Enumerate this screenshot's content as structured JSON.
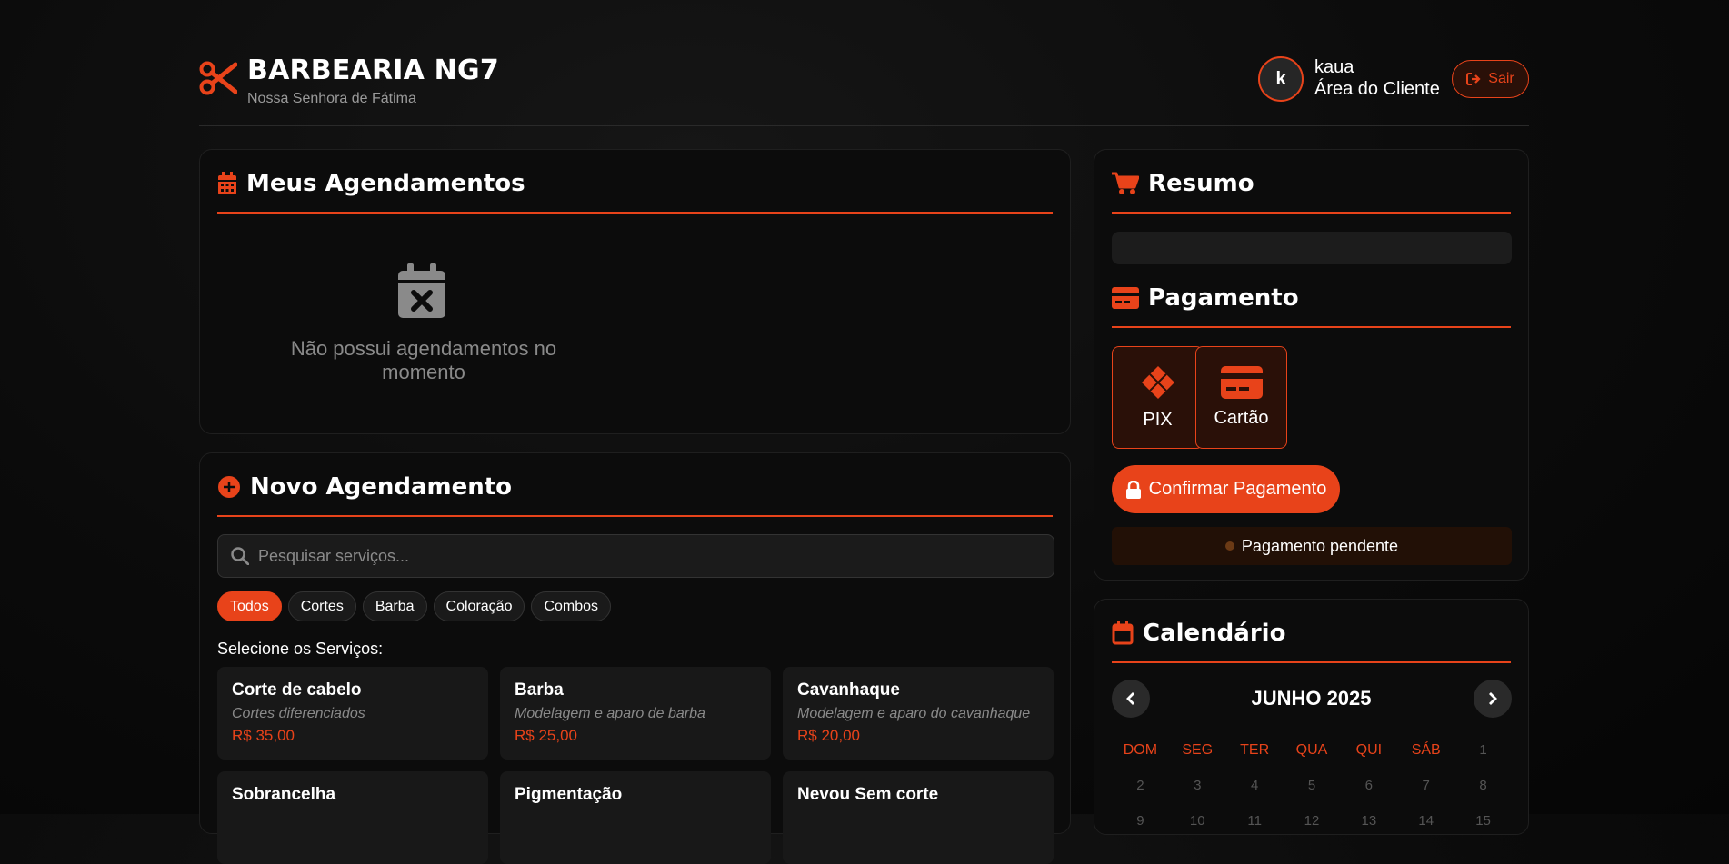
{
  "brand": {
    "title": "BARBEARIA NG7",
    "subtitle": "Nossa Senhora de Fátima",
    "icon": "scissors-icon"
  },
  "user": {
    "avatar_letter": "k",
    "name": "kaua",
    "role": "Área do Cliente",
    "logout_label": "Sair"
  },
  "appointments": {
    "title": "Meus Agendamentos",
    "empty_text": "Não possui agendamentos no momento"
  },
  "new_appointment": {
    "title": "Novo Agendamento",
    "search_placeholder": "Pesquisar serviços...",
    "filters": [
      "Todos",
      "Cortes",
      "Barba",
      "Coloração",
      "Combos"
    ],
    "active_filter": "Todos",
    "select_label": "Selecione os Serviços:",
    "services": [
      {
        "name": "Corte de cabelo",
        "desc": "Cortes diferenciados",
        "price": "R$ 35,00"
      },
      {
        "name": "Barba",
        "desc": "Modelagem e aparo de barba",
        "price": "R$ 25,00"
      },
      {
        "name": "Cavanhaque",
        "desc": "Modelagem e aparo do cavanhaque",
        "price": "R$ 20,00"
      },
      {
        "name": "Sobrancelha",
        "desc": "",
        "price": ""
      },
      {
        "name": "Pigmentação",
        "desc": "",
        "price": ""
      },
      {
        "name": "Nevou Sem corte",
        "desc": "",
        "price": ""
      }
    ]
  },
  "summary": {
    "title": "Resumo"
  },
  "payment": {
    "title": "Pagamento",
    "options": [
      "PIX",
      "Cartão"
    ],
    "confirm_label": "Confirmar Pagamento",
    "status": "Pagamento pendente"
  },
  "calendar": {
    "title": "Calendário",
    "month": "JUNHO 2025",
    "weekdays": [
      "DOM",
      "SEG",
      "TER",
      "QUA",
      "QUI",
      "SÁB"
    ],
    "days": [
      "1",
      "2",
      "3",
      "4",
      "5",
      "6",
      "7",
      "8",
      "9",
      "10",
      "11",
      "12",
      "13",
      "14",
      "15"
    ]
  },
  "colors": {
    "accent": "#e8431a",
    "background": "#0b0b0b",
    "card": "#0c0c0c"
  }
}
